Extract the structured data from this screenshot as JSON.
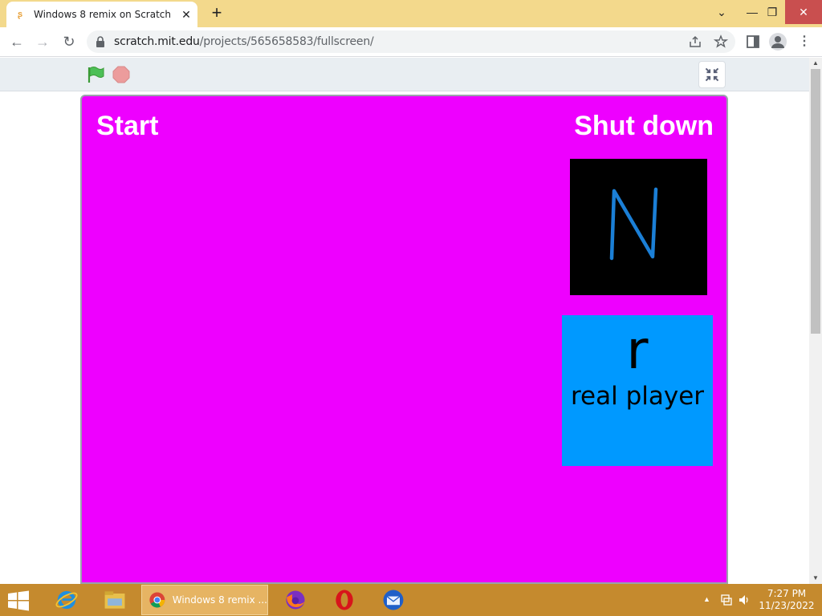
{
  "browser": {
    "tab": {
      "title": "Windows 8 remix on Scratch",
      "close": "✕"
    },
    "new_tab": "+",
    "window_controls": {
      "chevron": "⌄",
      "minimize": "—",
      "restore": "❐",
      "close": "✕"
    },
    "nav": {
      "back": "←",
      "forward": "→",
      "reload": "↻"
    },
    "address": {
      "host": "scratch.mit.edu",
      "path": "/projects/565658583/fullscreen/"
    }
  },
  "scratch": {
    "stage": {
      "start_label": "Start",
      "shutdown_label": "Shut down",
      "tile_n_letter": "N",
      "tile_r_letter": "r",
      "tile_r_label": "real player"
    },
    "colors": {
      "stage": "#ee00ff",
      "tile_n": "#000000",
      "tile_n_letter": "#1b7fd6",
      "tile_r": "#0099ff"
    }
  },
  "taskbar": {
    "active_task_label": "Windows 8 remix ...",
    "clock": {
      "time": "7:27 PM",
      "date": "11/23/2022"
    }
  }
}
